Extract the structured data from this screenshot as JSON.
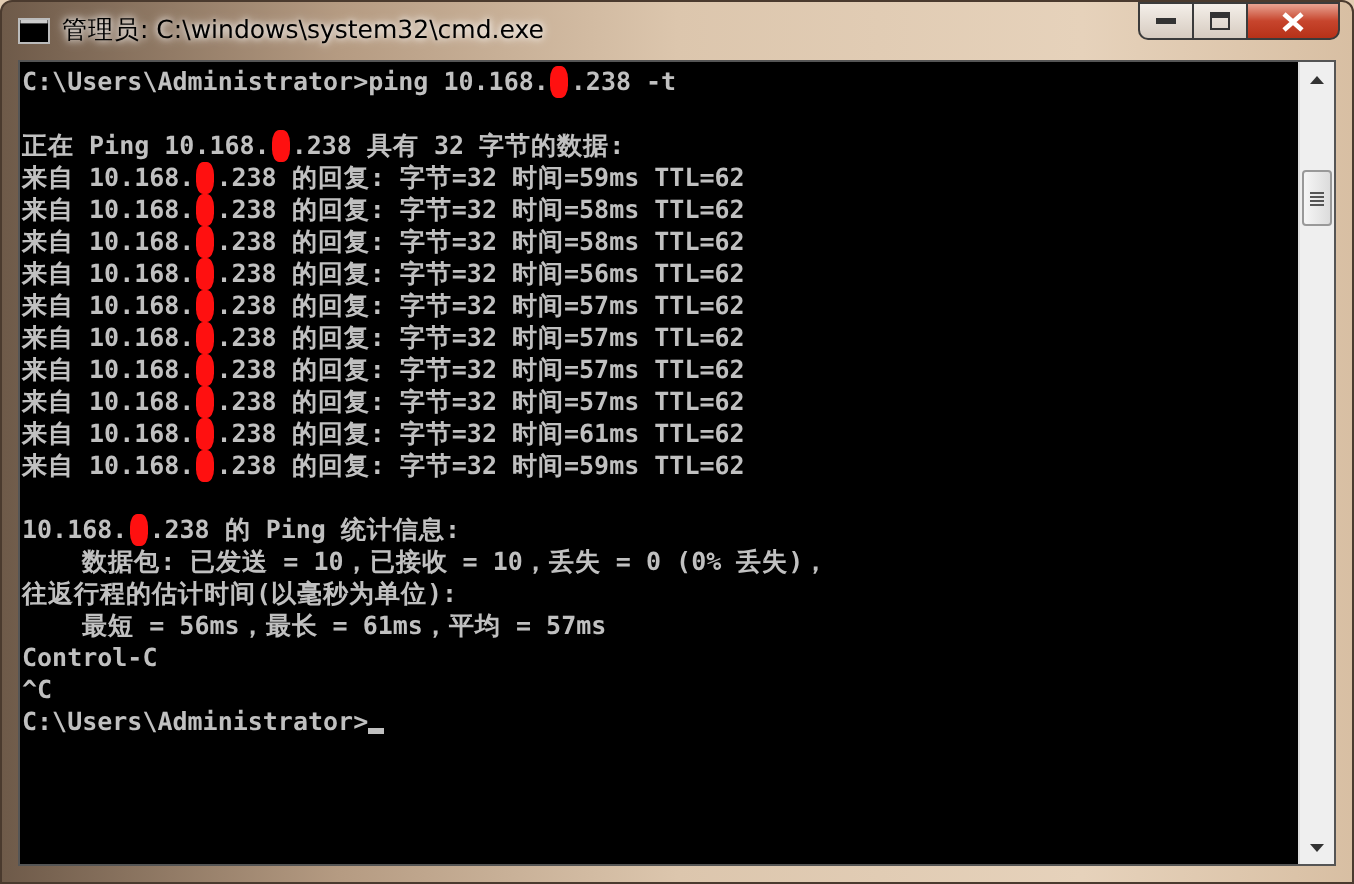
{
  "window": {
    "title": "管理员: C:\\windows\\system32\\cmd.exe"
  },
  "console": {
    "lines": [
      {
        "kind": "text",
        "parts": [
          "C:\\Users\\Administrator>ping 10.168.",
          ".238 -t"
        ]
      },
      {
        "kind": "blank"
      },
      {
        "kind": "text",
        "parts": [
          "正在 Ping 10.168.",
          ".238 具有 32 字节的数据:"
        ]
      },
      {
        "kind": "text",
        "parts": [
          "来自 10.168.",
          ".238 的回复: 字节=32 时间=59ms TTL=62"
        ]
      },
      {
        "kind": "text",
        "parts": [
          "来自 10.168.",
          ".238 的回复: 字节=32 时间=58ms TTL=62"
        ]
      },
      {
        "kind": "text",
        "parts": [
          "来自 10.168.",
          ".238 的回复: 字节=32 时间=58ms TTL=62"
        ]
      },
      {
        "kind": "text",
        "parts": [
          "来自 10.168.",
          ".238 的回复: 字节=32 时间=56ms TTL=62"
        ]
      },
      {
        "kind": "text",
        "parts": [
          "来自 10.168.",
          ".238 的回复: 字节=32 时间=57ms TTL=62"
        ]
      },
      {
        "kind": "text",
        "parts": [
          "来自 10.168.",
          ".238 的回复: 字节=32 时间=57ms TTL=62"
        ]
      },
      {
        "kind": "text",
        "parts": [
          "来自 10.168.",
          ".238 的回复: 字节=32 时间=57ms TTL=62"
        ]
      },
      {
        "kind": "text",
        "parts": [
          "来自 10.168.",
          ".238 的回复: 字节=32 时间=57ms TTL=62"
        ]
      },
      {
        "kind": "text",
        "parts": [
          "来自 10.168.",
          ".238 的回复: 字节=32 时间=61ms TTL=62"
        ]
      },
      {
        "kind": "text",
        "parts": [
          "来自 10.168.",
          ".238 的回复: 字节=32 时间=59ms TTL=62"
        ]
      },
      {
        "kind": "blank"
      },
      {
        "kind": "text",
        "parts": [
          "10.168.",
          ".238 的 Ping 统计信息:"
        ]
      },
      {
        "kind": "text",
        "parts": [
          "    数据包: 已发送 = 10，已接收 = 10，丢失 = 0 (0% 丢失)，"
        ]
      },
      {
        "kind": "text",
        "parts": [
          "往返行程的估计时间(以毫秒为单位):"
        ]
      },
      {
        "kind": "text",
        "parts": [
          "    最短 = 56ms，最长 = 61ms，平均 = 57ms"
        ]
      },
      {
        "kind": "text",
        "parts": [
          "Control-C"
        ]
      },
      {
        "kind": "text",
        "parts": [
          "^C"
        ]
      },
      {
        "kind": "text",
        "parts": [
          "C:\\Users\\Administrator>"
        ]
      }
    ],
    "cursor_after_last_line": true
  }
}
